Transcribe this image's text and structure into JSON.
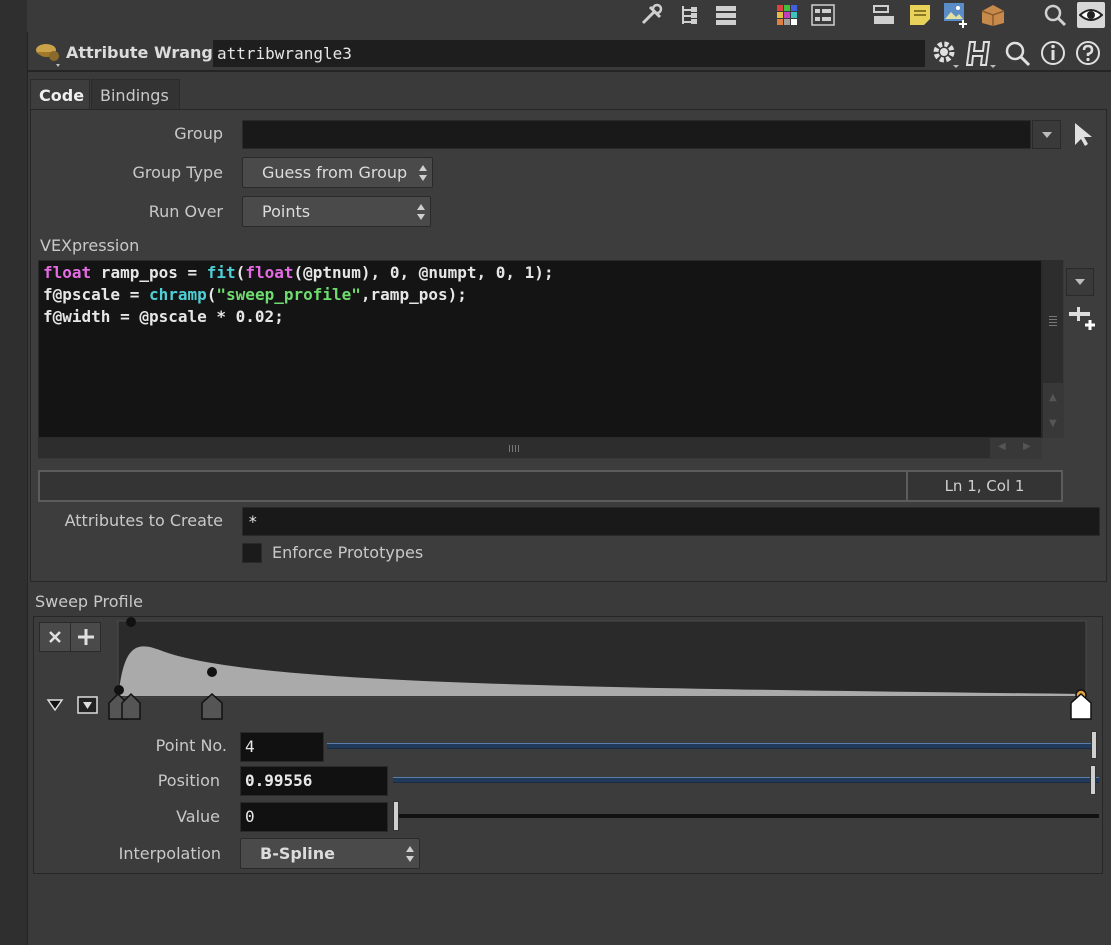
{
  "toolbar": {
    "icons": [
      "tools-icon",
      "tree-icon",
      "list-icon",
      "color-palette-icon",
      "parameters-icon",
      "layout-icon",
      "sticky-note-icon",
      "add-image-icon",
      "box-icon",
      "search-icon",
      "eye-icon"
    ]
  },
  "header": {
    "node_type": "Attribute Wrangle",
    "node_name": "attribwrangle3"
  },
  "tabs": [
    {
      "label": "Code"
    },
    {
      "label": "Bindings"
    }
  ],
  "form": {
    "group_label": "Group",
    "group_value": "",
    "group_type_label": "Group Type",
    "group_type_value": "Guess from Group",
    "run_over_label": "Run Over",
    "run_over_value": "Points",
    "vexpression_label": "VEXpression",
    "status_cursor": "Ln 1, Col 1",
    "attributes_label": "Attributes to Create",
    "attributes_value": "*",
    "enforce_label": "Enforce Prototypes"
  },
  "code_lines": [
    "float ramp_pos = fit(float(@ptnum), 0, @numpt, 0, 1);",
    "f@pscale = chramp(\"sweep_profile\",ramp_pos);",
    "f@width = @pscale * 0.02;"
  ],
  "ramp": {
    "label": "Sweep Profile",
    "point_no_label": "Point No.",
    "point_no_value": "4",
    "point_no_fraction": 1.0,
    "position_label": "Position",
    "position_value": "0.99556",
    "value_label": "Value",
    "value_value": "0",
    "interpolation_label": "Interpolation",
    "interpolation_value": "B-Spline"
  },
  "colors": {
    "keyword": "#e46be4",
    "function": "#4fd0d6",
    "string": "#6fdc6f",
    "selected_key": "#e0a040"
  }
}
